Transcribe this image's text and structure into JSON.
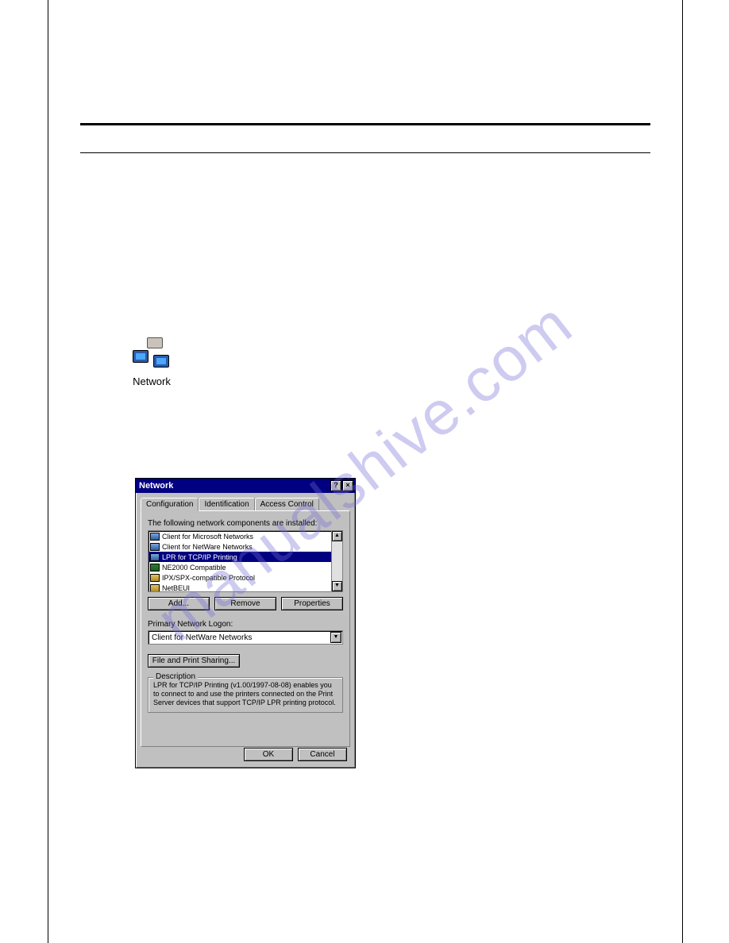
{
  "watermark": "manualshive.com",
  "desktopIcon": {
    "label": "Network"
  },
  "dialog": {
    "title": "Network",
    "help": "?",
    "close": "×",
    "tabs": [
      {
        "label": "Configuration",
        "active": true
      },
      {
        "label": "Identification",
        "active": false
      },
      {
        "label": "Access Control",
        "active": false
      }
    ],
    "listLabel": "The following network components are installed:",
    "items": [
      {
        "label": "Client for Microsoft Networks",
        "icon": "ic-client",
        "selected": false
      },
      {
        "label": "Client for NetWare Networks",
        "icon": "ic-client",
        "selected": false
      },
      {
        "label": "LPR for TCP/IP Printing",
        "icon": "ic-client",
        "selected": true
      },
      {
        "label": "NE2000 Compatible",
        "icon": "ic-adapter",
        "selected": false
      },
      {
        "label": "IPX/SPX-compatible Protocol",
        "icon": "ic-protocol",
        "selected": false
      },
      {
        "label": "NetBEUI",
        "icon": "ic-protocol",
        "selected": false
      }
    ],
    "buttons": {
      "add": "Add...",
      "remove": "Remove",
      "properties": "Properties"
    },
    "logonLabel": "Primary Network Logon:",
    "logonValue": "Client for NetWare Networks",
    "shareButton": "File and Print Sharing...",
    "descLegend": "Description",
    "descText": "LPR for TCP/IP Printing (v1.00/1997-08-08) enables you to connect to and use the printers connected on the Print Server devices that support TCP/IP LPR printing protocol.",
    "ok": "OK",
    "cancel": "Cancel"
  }
}
